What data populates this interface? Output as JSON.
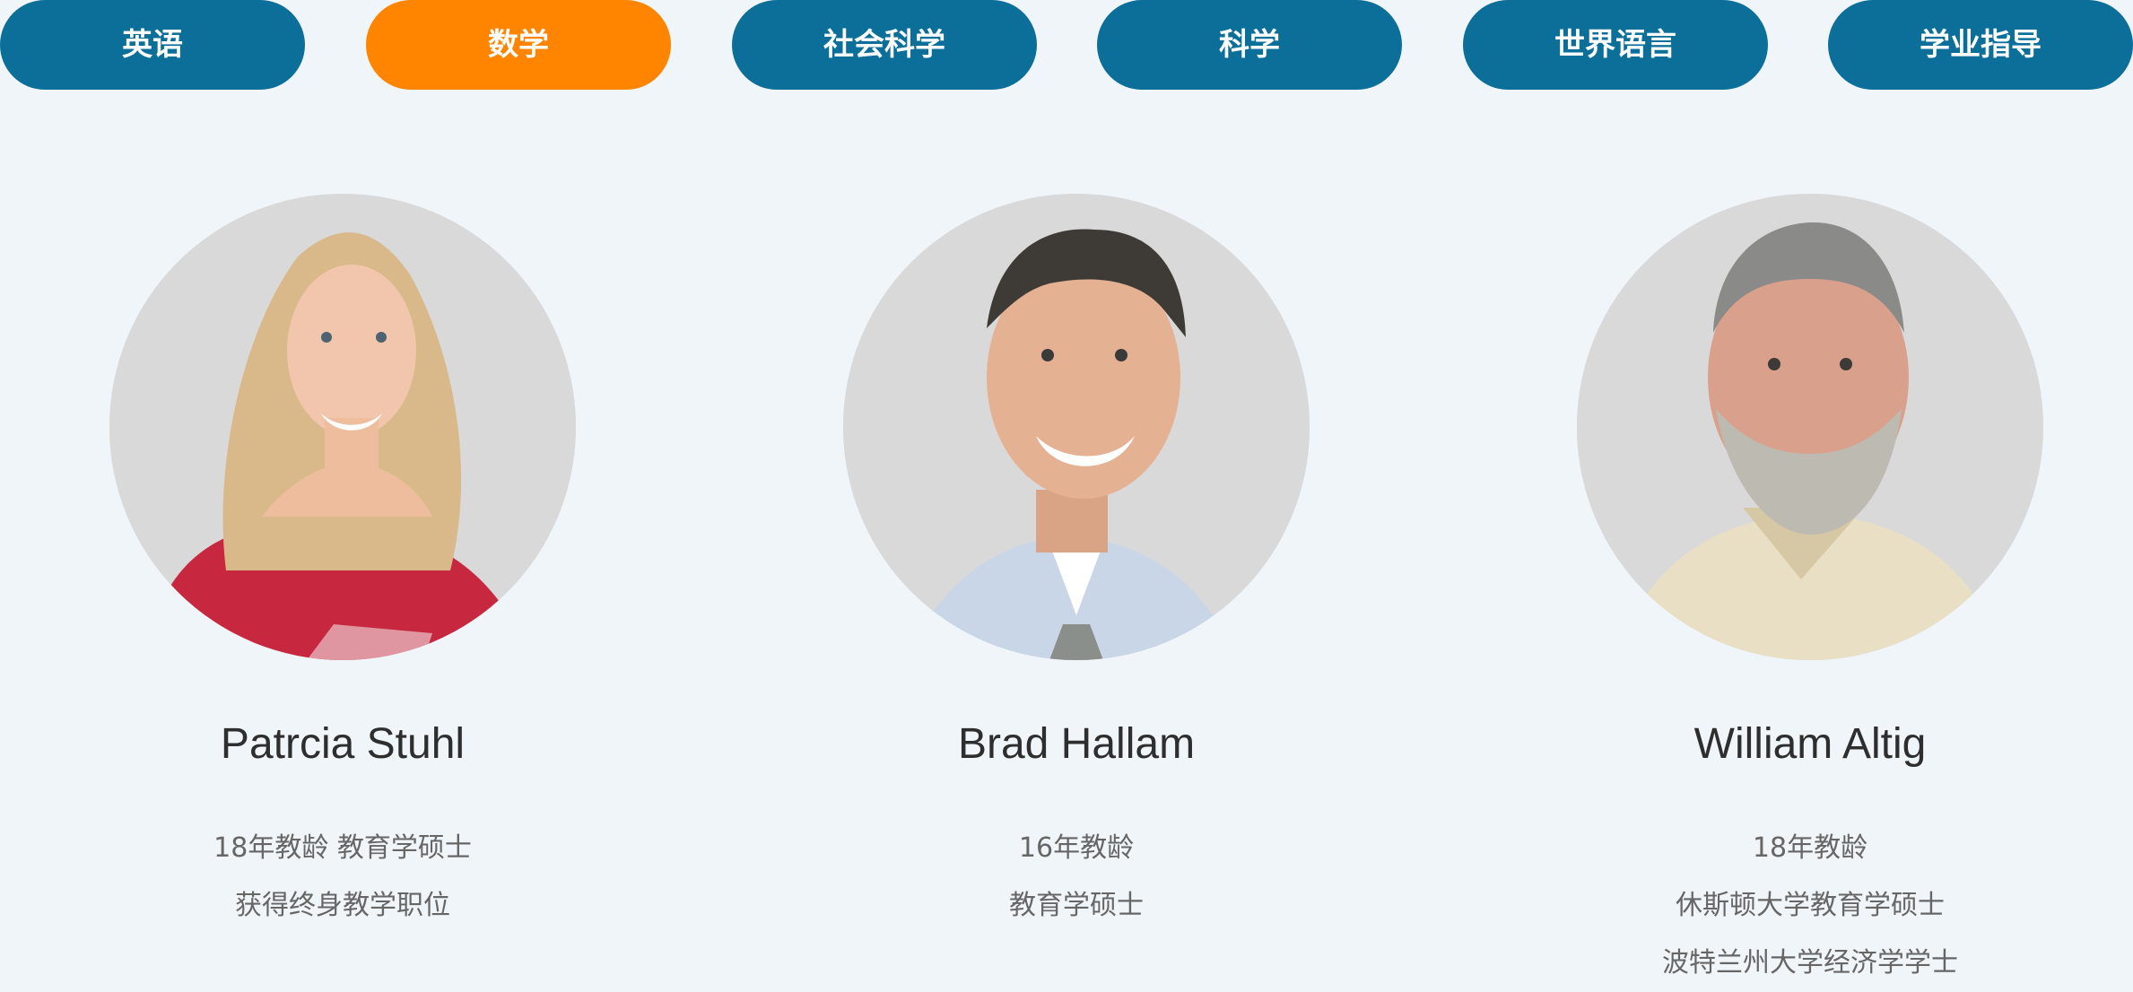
{
  "tabs": [
    {
      "label": "英语",
      "active": false
    },
    {
      "label": "数学",
      "active": true
    },
    {
      "label": "社会科学",
      "active": false
    },
    {
      "label": "科学",
      "active": false
    },
    {
      "label": "世界语言",
      "active": false
    },
    {
      "label": "学业指导",
      "active": false
    }
  ],
  "colors": {
    "tab_default": "#0c6f99",
    "tab_active": "#ff8400",
    "background": "#f0f5f9"
  },
  "teachers": [
    {
      "name": "Patrcia Stuhl",
      "details": [
        "18年教龄 教育学硕士",
        "获得终身教学职位"
      ]
    },
    {
      "name": "Brad Hallam",
      "details": [
        "16年教龄",
        "教育学硕士"
      ]
    },
    {
      "name": "William Altig",
      "details": [
        "18年教龄",
        "休斯顿大学教育学硕士",
        "波特兰州大学经济学学士"
      ]
    }
  ]
}
